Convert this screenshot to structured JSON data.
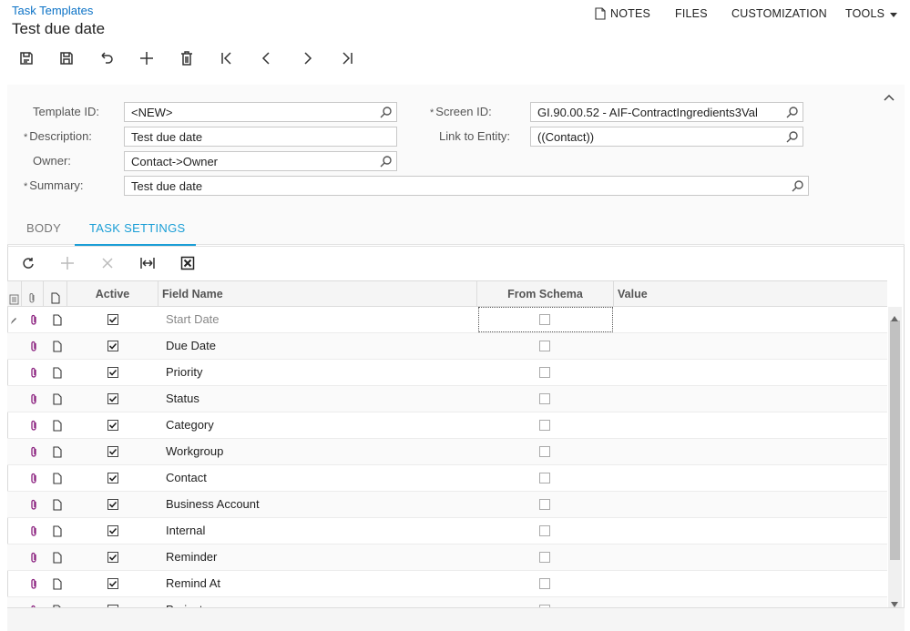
{
  "breadcrumb": "Task Templates",
  "title": "Test due date",
  "top_menu": {
    "notes": "NOTES",
    "files": "FILES",
    "customization": "CUSTOMIZATION",
    "tools": "TOOLS"
  },
  "form": {
    "template_id_label": "Template ID:",
    "template_id_value": "<NEW>",
    "description_label": "Description:",
    "description_value": "Test due date",
    "owner_label": "Owner:",
    "owner_value": "Contact->Owner",
    "summary_label": "Summary:",
    "summary_value": "Test due date",
    "screen_id_label": "Screen ID:",
    "screen_id_value": "GI.90.00.52 - AIF-ContractIngredients3Val",
    "link_entity_label": "Link to Entity:",
    "link_entity_value": "((Contact))",
    "required_marker": "*"
  },
  "tabs": {
    "body": "BODY",
    "task_settings": "TASK SETTINGS"
  },
  "grid": {
    "columns": {
      "active": "Active",
      "field_name": "Field Name",
      "from_schema": "From Schema",
      "value": "Value"
    },
    "rows": [
      {
        "field": "Start Date",
        "active": true,
        "from_schema": false
      },
      {
        "field": "Due Date",
        "active": true,
        "from_schema": false
      },
      {
        "field": "Priority",
        "active": true,
        "from_schema": false
      },
      {
        "field": "Status",
        "active": true,
        "from_schema": false
      },
      {
        "field": "Category",
        "active": true,
        "from_schema": false
      },
      {
        "field": "Workgroup",
        "active": true,
        "from_schema": false
      },
      {
        "field": "Contact",
        "active": true,
        "from_schema": false
      },
      {
        "field": "Business Account",
        "active": true,
        "from_schema": false
      },
      {
        "field": "Internal",
        "active": true,
        "from_schema": false
      },
      {
        "field": "Reminder",
        "active": true,
        "from_schema": false
      },
      {
        "field": "Remind At",
        "active": true,
        "from_schema": false
      },
      {
        "field": "Project",
        "active": true,
        "from_schema": false
      }
    ]
  },
  "icons": {
    "toolbar": [
      "save-close-icon",
      "save-icon",
      "undo-icon",
      "add-icon",
      "delete-icon",
      "first-icon",
      "previous-icon",
      "next-icon",
      "last-icon"
    ],
    "grid_toolbar": [
      "refresh-icon",
      "add-row-icon",
      "delete-row-icon",
      "fit-columns-icon",
      "export-excel-icon"
    ]
  },
  "colors": {
    "accent": "#1a9ed6",
    "link": "#0b72c6",
    "attach_icon": "#8a1f7e"
  }
}
